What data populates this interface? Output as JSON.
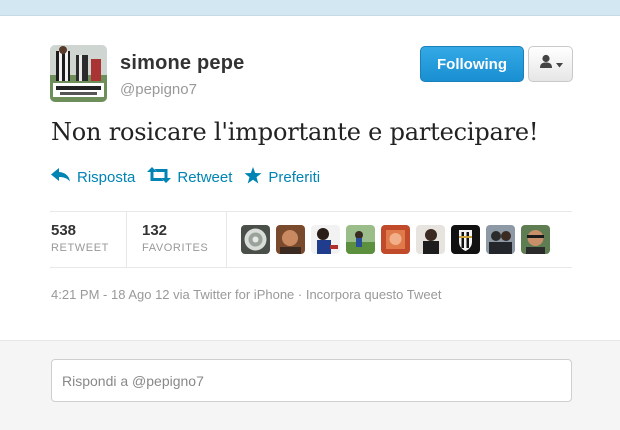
{
  "user": {
    "name": "simone pepe",
    "handle": "@pepigno7"
  },
  "header": {
    "follow_label": "Following"
  },
  "tweet": {
    "text": "Non rosicare l'importante e partecipare!"
  },
  "actions": {
    "reply": "Risposta",
    "retweet": "Retweet",
    "favorite": "Preferiti"
  },
  "stats": {
    "retweets": "538",
    "retweets_label": "RETWEET",
    "favorites": "132",
    "favorites_label": "FAVORITES",
    "favoriter_count": 9
  },
  "meta": {
    "line": "4:21 PM - 18 Ago 12 via Twitter for iPhone · Incorpora questo Tweet"
  },
  "reply_box": {
    "placeholder": "Rispondi a @pepigno7"
  },
  "colors": {
    "link": "#0084b4",
    "follow_button": "#1a8fd1",
    "muted_text": "#999999",
    "top_strip": "#d2e7f1"
  },
  "icons": {
    "reply": "reply-arrow-icon",
    "retweet": "retweet-icon",
    "favorite": "star-icon",
    "user_menu": "user-icon",
    "dropdown": "caret-down-icon"
  }
}
